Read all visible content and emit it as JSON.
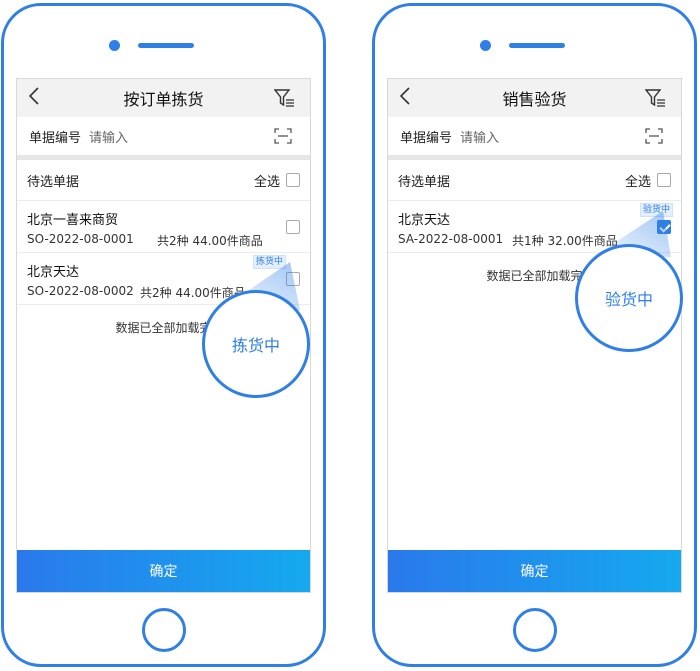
{
  "left": {
    "title": "按订单拣货",
    "search": {
      "label": "单据编号",
      "placeholder": "请输入"
    },
    "section": {
      "label": "待选单据",
      "select_all": "全选"
    },
    "orders": [
      {
        "name": "北京一喜来商贸",
        "code": "SO-2022-08-0001",
        "summary": "共2种 44.00件商品",
        "checked": false,
        "tag": ""
      },
      {
        "name": "北京天达",
        "code": "SO-2022-08-0002",
        "summary": "共2种 44.00件商品",
        "checked": false,
        "tag": "拣货中"
      }
    ],
    "loaded_text": "数据已全部加载完",
    "callout_text": "拣货中",
    "confirm_label": "确定"
  },
  "right": {
    "title": "销售验货",
    "search": {
      "label": "单据编号",
      "placeholder": "请输入"
    },
    "section": {
      "label": "待选单据",
      "select_all": "全选"
    },
    "orders": [
      {
        "name": "北京天达",
        "code": "SA-2022-08-0001",
        "summary": "共1种 32.00件商品",
        "checked": true,
        "tag": "验货中"
      }
    ],
    "loaded_text": "数据已全部加载完",
    "callout_text": "验货中",
    "confirm_label": "确定"
  },
  "colors": {
    "accent": "#2f7fe6",
    "button_start": "#2a79ec",
    "button_end": "#15a9ee",
    "tag_bg": "#e3efff"
  },
  "icons": {
    "back": "chevron-left-icon",
    "filter": "filter-icon",
    "scan": "scan-icon",
    "check": "checkmark-icon"
  }
}
